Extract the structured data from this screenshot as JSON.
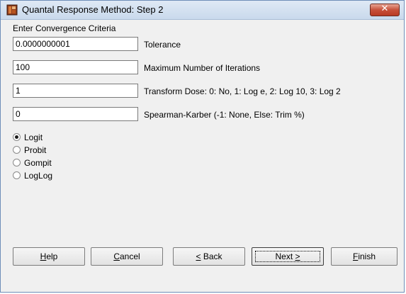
{
  "window": {
    "title": "Quantal Response Method: Step 2",
    "app_icon": "tablet-icon",
    "close_icon": "close-x-icon"
  },
  "form": {
    "section_label": "Enter Convergence Criteria",
    "fields": [
      {
        "value": "0.0000000001",
        "label": "Tolerance"
      },
      {
        "value": "100",
        "label": "Maximum Number of Iterations"
      },
      {
        "value": "1",
        "label": "Transform Dose: 0: No, 1: Log e, 2: Log 10, 3: Log 2"
      },
      {
        "value": "0",
        "label": "Spearman-Karber (-1: None, Else: Trim %)"
      }
    ],
    "models": [
      {
        "label": "Logit",
        "checked": true
      },
      {
        "label": "Probit",
        "checked": false
      },
      {
        "label": "Gompit",
        "checked": false
      },
      {
        "label": "LogLog",
        "checked": false
      }
    ]
  },
  "buttons": {
    "help": {
      "key": "H",
      "rest": "elp"
    },
    "cancel": {
      "key": "C",
      "rest": "ancel"
    },
    "back": {
      "pre": "",
      "key": "<",
      "rest": " Back"
    },
    "next": {
      "pre": "Next ",
      "key": ">",
      "rest": ""
    },
    "finish": {
      "key": "F",
      "rest": "inish"
    }
  }
}
